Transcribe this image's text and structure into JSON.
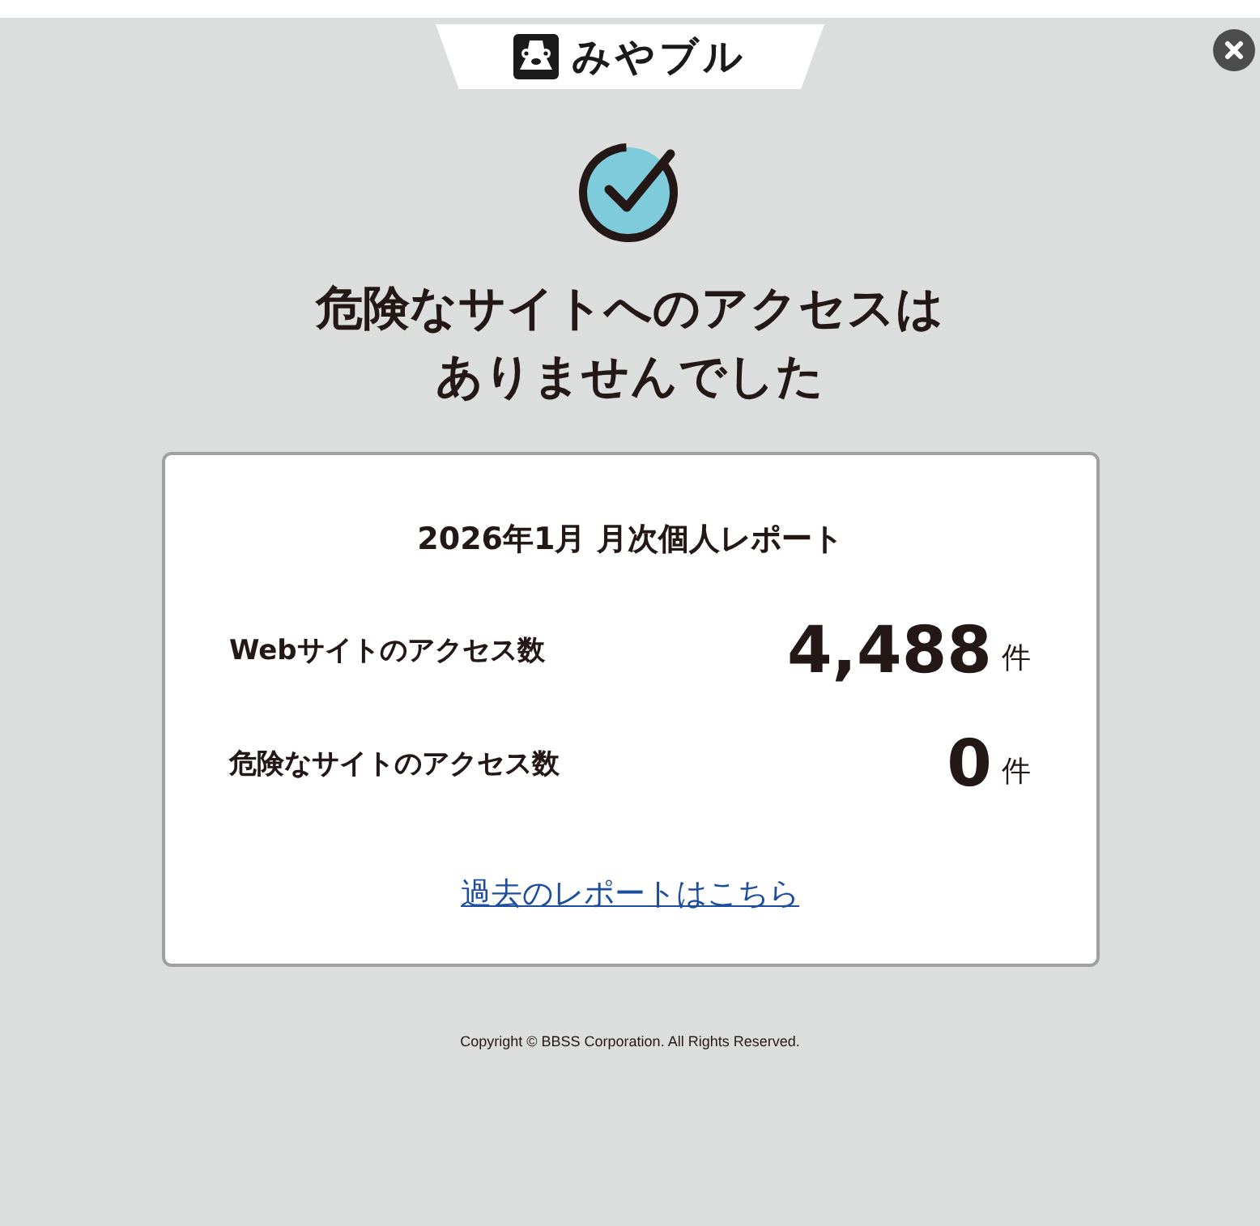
{
  "header": {
    "logo_text": "みやブル"
  },
  "title_lines": [
    "危険なサイトへのアクセスは",
    "ありませんでした"
  ],
  "report": {
    "title": "2026年1月 月次個人レポート",
    "rows": [
      {
        "label": "Webサイトのアクセス数",
        "value": "4,488",
        "unit": "件"
      },
      {
        "label": "危険なサイトのアクセス数",
        "value": "0",
        "unit": "件"
      }
    ],
    "link": "過去のレポートはこちら"
  },
  "footer": "Copyright © BBSS Corporation. All Rights Reserved."
}
